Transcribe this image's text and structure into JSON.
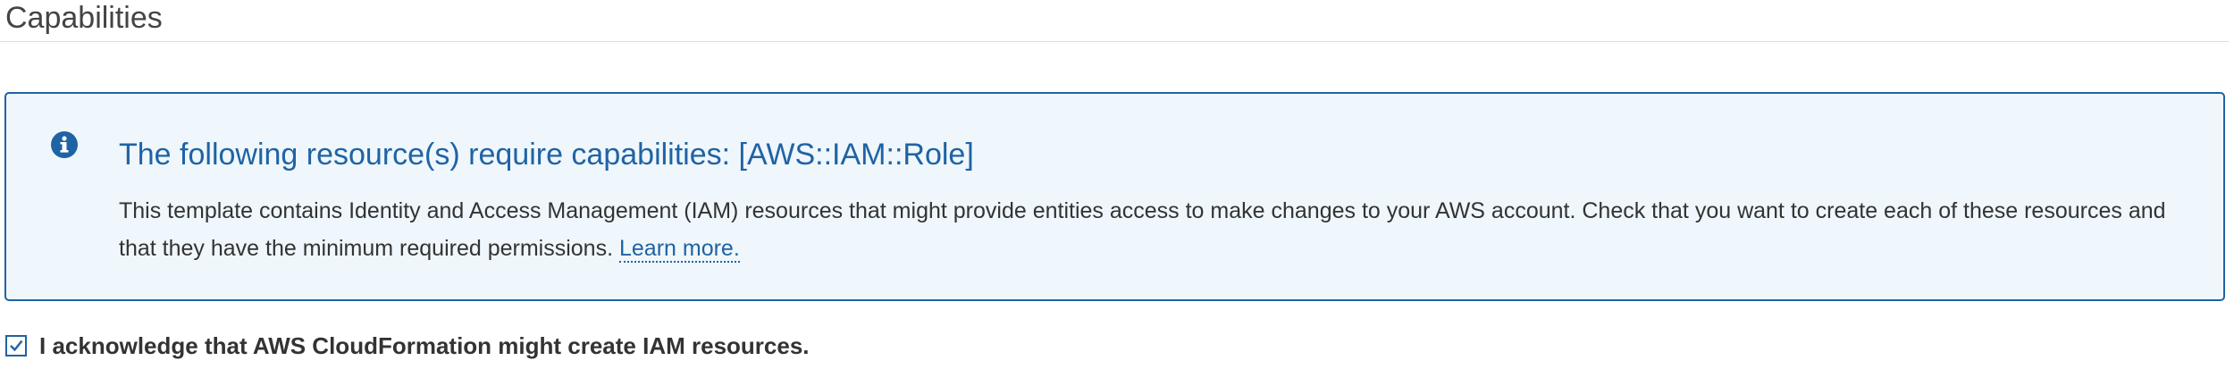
{
  "section": {
    "title": "Capabilities"
  },
  "info_alert": {
    "icon": "info-circle-icon",
    "title": "The following resource(s) require capabilities: [AWS::IAM::Role]",
    "body": "This template contains Identity and Access Management (IAM) resources that might provide entities access to make changes to your AWS account. Check that you want to create each of these resources and that they have the minimum required permissions. ",
    "link_text": "Learn more."
  },
  "acknowledge": {
    "checked": true,
    "label": "I acknowledge that AWS CloudFormation might create IAM resources."
  },
  "colors": {
    "accent": "#1f63a4",
    "alert_background": "#eff7fc",
    "text": "#333333"
  }
}
